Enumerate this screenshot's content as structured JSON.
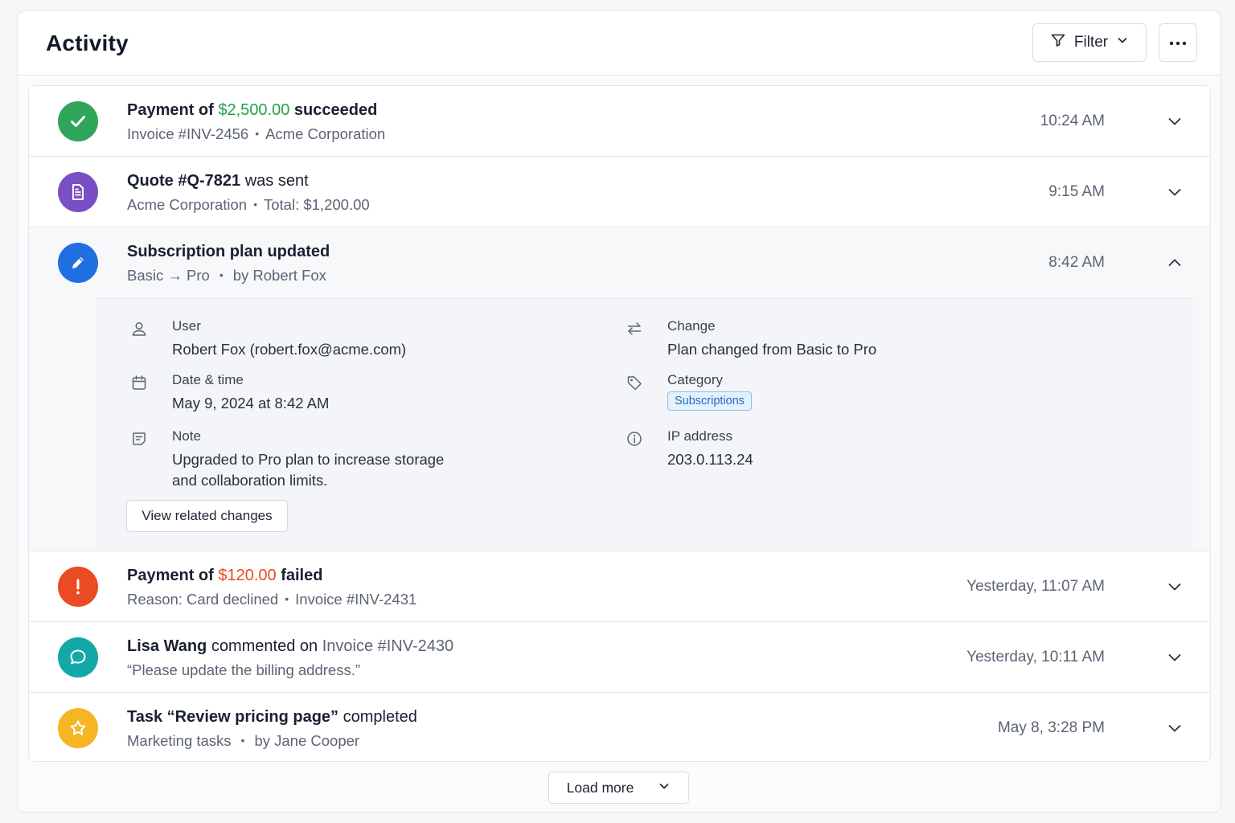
{
  "header": {
    "title": "Activity",
    "filter_label": "Filter"
  },
  "colors": {
    "success": "#2fa55a",
    "quote": "#7a4fc4",
    "edit": "#1f6fe0",
    "error": "#ea4b22",
    "comment": "#13a8a8",
    "task": "#f5b524",
    "success_amount": "#22a34a",
    "error_amount": "#e84a1e"
  },
  "activities": [
    {
      "icon": "check-icon",
      "title_pre": "Payment of ",
      "title_highlight": "$2,500.00",
      "title_post": " succeeded",
      "sub_a": "Invoice #INV-2456",
      "sub_b": "Acme Corporation",
      "time": "10:24 AM"
    },
    {
      "icon": "document-icon",
      "title_a": "Quote #Q-7821",
      "title_b": " was sent",
      "sub_a": "Acme Corporation",
      "sub_b": "Total: $1,200.00",
      "time": "9:15 AM"
    },
    {
      "icon": "pencil-icon",
      "title": "Subscription plan updated",
      "sub_a": "Basic → Pro",
      "sub_b": "by Robert Fox",
      "time": "8:42 AM",
      "details": {
        "user_label": "User",
        "user_value": "Robert Fox (robert.fox@acme.com)",
        "date_label": "Date & time",
        "date_value": "May 9, 2024 at 8:42 AM",
        "note_label": "Note",
        "note_line1": "Upgraded to Pro plan to increase storage",
        "note_line2": "and collaboration limits.",
        "change_label": "Change",
        "change_value": "Plan changed from Basic to Pro",
        "category_label": "Category",
        "category_value": "Subscriptions",
        "ip_label": "IP address",
        "ip_value": "203.0.113.24",
        "related_button": "View related changes"
      }
    },
    {
      "icon": "alert-icon",
      "title_pre": "Payment of ",
      "title_highlight": "$120.00",
      "title_post": " failed",
      "sub_a": "Reason: Card declined",
      "sub_b": "Invoice #INV-2431",
      "time": "Yesterday, 11:07 AM"
    },
    {
      "icon": "comment-icon",
      "title_name": "Lisa Wang",
      "title_mid": " commented on ",
      "title_ref": "Invoice #INV-2430",
      "sub": "“Please update the billing address.”",
      "time": "Yesterday, 10:11 AM"
    },
    {
      "icon": "star-icon",
      "title_a": "Task “Review pricing page”",
      "title_b": " completed",
      "sub_a": "Marketing tasks",
      "sub_b": "by Jane Cooper",
      "time": "May 8, 3:28 PM"
    }
  ],
  "footer": {
    "load_more": "Load more"
  }
}
